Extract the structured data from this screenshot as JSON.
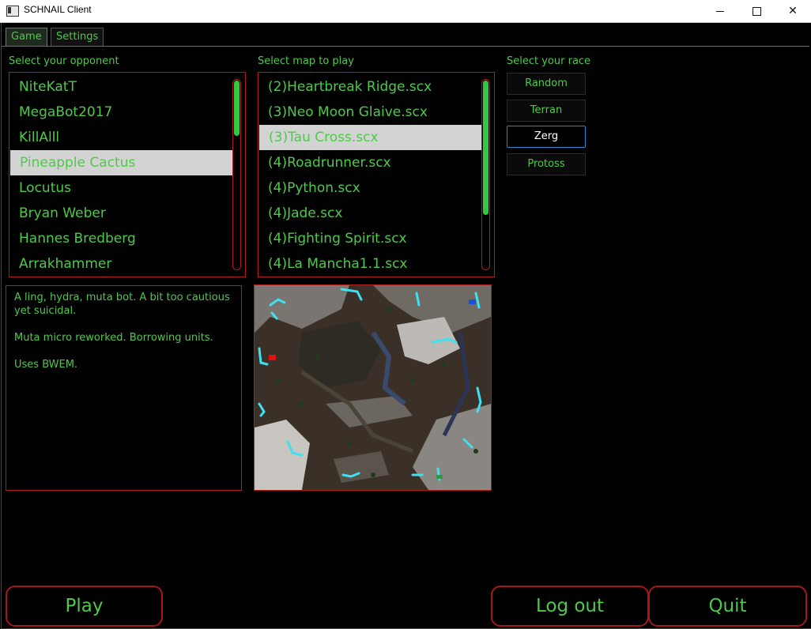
{
  "window": {
    "title": "SCHNAIL Client"
  },
  "tabs": [
    {
      "label": "Game",
      "active": true
    },
    {
      "label": "Settings",
      "active": false
    }
  ],
  "opponent": {
    "label": "Select your opponent",
    "items": [
      "NiteKatT",
      "MegaBot2017",
      "KillAlll",
      "Pineapple Cactus",
      "Locutus",
      "Bryan Weber",
      "Hannes Bredberg",
      "Arrakhammer"
    ],
    "selected": "Pineapple Cactus"
  },
  "map": {
    "label": "Select map to play",
    "items": [
      "(2)Heartbreak Ridge.scx",
      "(3)Neo Moon Glaive.scx",
      "(3)Tau Cross.scx",
      "(4)Roadrunner.scx",
      "(4)Python.scx",
      "(4)Jade.scx",
      "(4)Fighting Spirit.scx",
      "(4)La Mancha1.1.scx"
    ],
    "selected": "(3)Tau Cross.scx"
  },
  "race": {
    "label": "Select your race",
    "options": [
      "Random",
      "Terran",
      "Zerg",
      "Protoss"
    ],
    "selected": "Zerg"
  },
  "description": {
    "paragraphs": [
      "A ling, hydra, muta bot. A bit too cautious yet suicidal.",
      "Muta micro reworked. Borrowing units.",
      "Uses BWEM."
    ]
  },
  "buttons": {
    "play": "Play",
    "logout": "Log out",
    "quit": "Quit"
  },
  "colors": {
    "accent_text": "#4fc94a",
    "border": "#b01c1c",
    "scroll_thumb": "#35c83a",
    "selection_bg": "#d3d3d3",
    "race_selected_border": "#1e8ad8"
  }
}
